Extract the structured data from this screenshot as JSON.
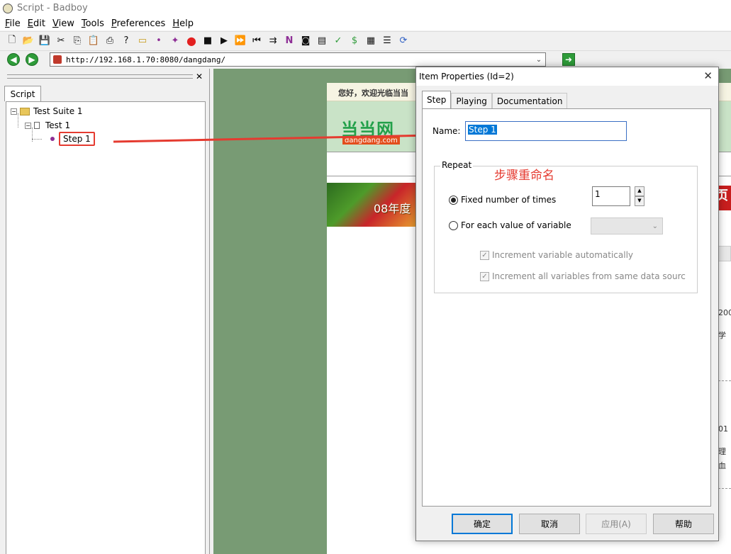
{
  "window": {
    "title": "Script - Badboy"
  },
  "menu": [
    "File",
    "Edit",
    "View",
    "Tools",
    "Preferences",
    "Help"
  ],
  "toolbar": {
    "icons": [
      "new-icon",
      "open-icon",
      "save-icon",
      "cut-icon",
      "copy-icon",
      "paste-icon",
      "print-icon",
      "help-icon",
      "add-suite-icon",
      "add-step-icon",
      "add-item-icon",
      "record-icon",
      "stop-icon",
      "play-icon",
      "play-all-icon",
      "rewind-icon",
      "step-forward-icon",
      "navigation-icon",
      "screenshot-icon",
      "report-icon",
      "assertion-icon",
      "variable-icon",
      "table-icon",
      "graph-icon",
      "refresh-icon"
    ]
  },
  "address": {
    "url": "http://192.168.1.70:8080/dangdang/"
  },
  "left_pane": {
    "tab": "Script",
    "tree": [
      {
        "label": "Test Suite 1",
        "level": 0
      },
      {
        "label": "Test 1",
        "level": 1
      },
      {
        "label": "Step 1",
        "level": 2
      }
    ]
  },
  "page": {
    "welcome": "您好，欢迎光临当当",
    "logo_cn": "当当网",
    "logo_en": "dangdang.com",
    "banner": "08年度",
    "right_fragments": {
      "a": "页",
      "b": "C,",
      "c": "200",
      "d": "学",
      "e": "01",
      "f": "理",
      "g": "血"
    }
  },
  "dialog": {
    "title": "Item Properties (Id=2)",
    "tabs": [
      "Step",
      "Playing",
      "Documentation"
    ],
    "name_label": "Name:",
    "name_value": "Step 1",
    "repeat_label": "Repeat",
    "annotation": "步骤重命名",
    "fixed_label": "Fixed number of times",
    "fixed_value": "1",
    "each_label": "For each value of variable",
    "inc_auto": "Increment variable automatically",
    "inc_all": "Increment all variables from same data sourc",
    "buttons": {
      "ok": "确定",
      "cancel": "取消",
      "apply": "应用(A)",
      "help": "帮助"
    }
  }
}
